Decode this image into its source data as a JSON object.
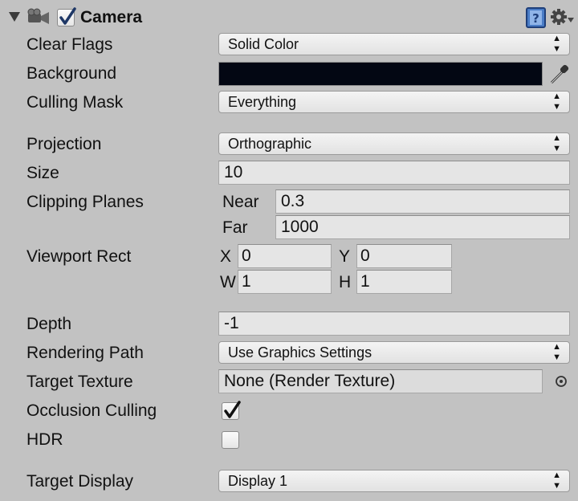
{
  "component": {
    "title": "Camera",
    "enabled": true
  },
  "icons": {
    "foldout": "foldout-triangle-icon",
    "component": "camera-icon",
    "help": "help-book-icon",
    "settings": "gear-icon",
    "eyedropper": "eyedropper-icon",
    "object_picker": "object-picker-icon"
  },
  "colors": {
    "background_swatch": "#030713",
    "panel_bg": "#c2c2c2",
    "help_icon_blue": "#4a7cc6"
  },
  "fields": {
    "clear_flags": {
      "label": "Clear Flags",
      "value": "Solid Color"
    },
    "background": {
      "label": "Background",
      "color": "#030713"
    },
    "culling_mask": {
      "label": "Culling Mask",
      "value": "Everything"
    },
    "projection": {
      "label": "Projection",
      "value": "Orthographic"
    },
    "size": {
      "label": "Size",
      "value": "10"
    },
    "clipping_planes": {
      "label": "Clipping Planes",
      "near_label": "Near",
      "near": "0.3",
      "far_label": "Far",
      "far": "1000"
    },
    "viewport_rect": {
      "label": "Viewport Rect",
      "x_label": "X",
      "x": "0",
      "y_label": "Y",
      "y": "0",
      "w_label": "W",
      "w": "1",
      "h_label": "H",
      "h": "1"
    },
    "depth": {
      "label": "Depth",
      "value": "-1"
    },
    "rendering_path": {
      "label": "Rendering Path",
      "value": "Use Graphics Settings"
    },
    "target_texture": {
      "label": "Target Texture",
      "value": "None (Render Texture)"
    },
    "occlusion_culling": {
      "label": "Occlusion Culling",
      "checked": true
    },
    "hdr": {
      "label": "HDR",
      "checked": false
    },
    "target_display": {
      "label": "Target Display",
      "value": "Display 1"
    }
  }
}
